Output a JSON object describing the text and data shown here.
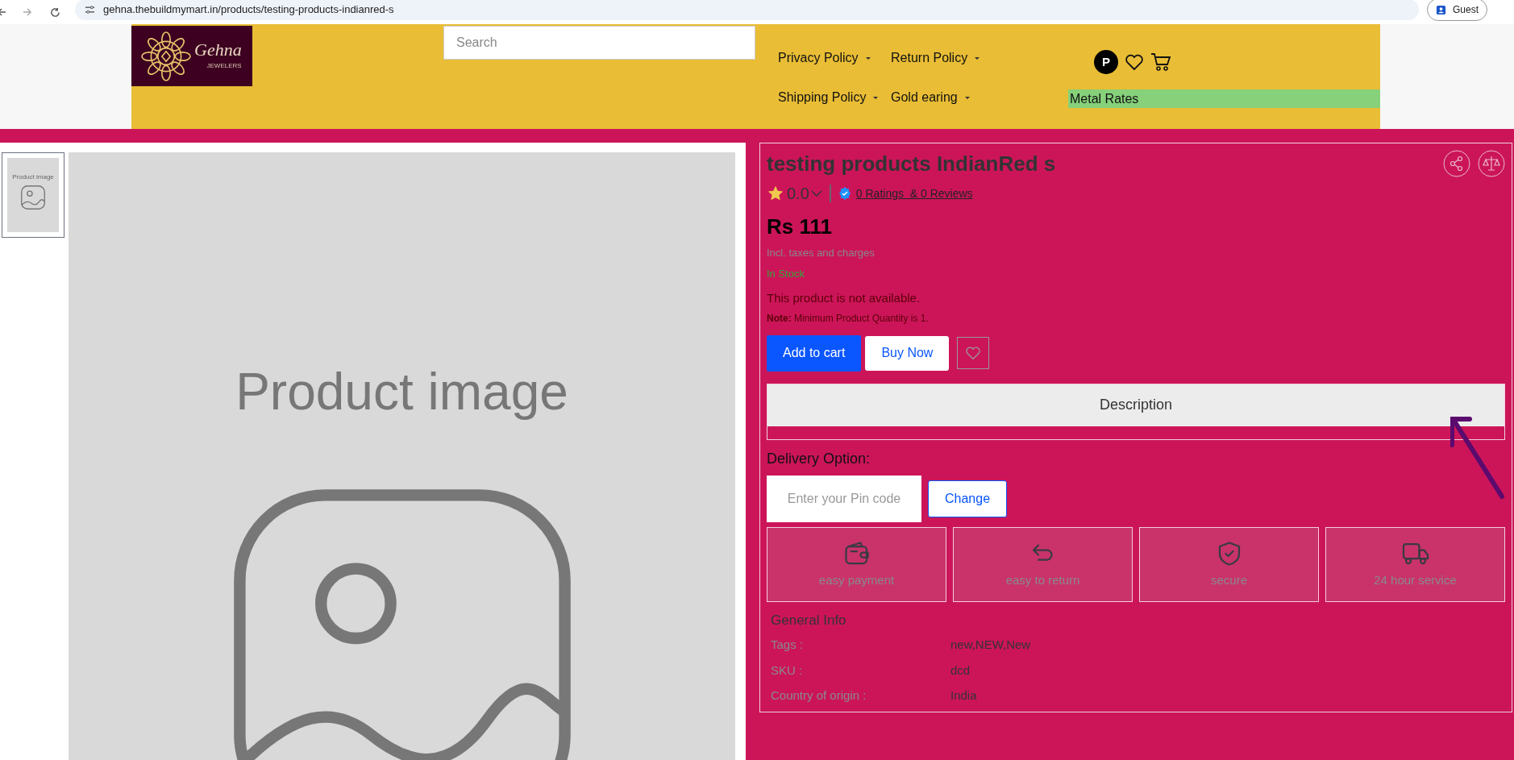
{
  "browser": {
    "url": "gehna.thebuildmymart.in/products/testing-products-indianred-s",
    "profile": "Guest"
  },
  "header": {
    "logo": {
      "name": "Gehna",
      "tagline": "JEWELERS"
    },
    "search": {
      "placeholder": "Search"
    },
    "nav": [
      {
        "label": "Privacy Policy"
      },
      {
        "label": "Return Policy"
      },
      {
        "label": "Shipping Policy"
      },
      {
        "label": "Gold earing"
      }
    ],
    "avatar": "P",
    "metal_rates": "Metal Rates"
  },
  "gallery": {
    "thumbnails": [
      {
        "caption": "Product image",
        "selected": true
      }
    ],
    "main_caption": "Product image"
  },
  "product": {
    "title": "testing products IndianRed s",
    "rating": "0.0",
    "reviews_link": "0 Ratings  & 0 Reviews",
    "price": "Rs 111",
    "tax_note": "Incl. taxes and charges",
    "stock": "In Stock",
    "availability": "This product is not available.",
    "note_label": "Note:",
    "note": "Minimum Product Quantity is 1.",
    "buttons": [
      {
        "label": "Add to cart",
        "kind": "primary"
      },
      {
        "label": "Buy Now",
        "kind": "secondary"
      }
    ],
    "tabs": [
      {
        "label": "Description",
        "selected": true
      }
    ],
    "delivery": {
      "label": "Delivery Option:",
      "placeholder": "Enter your Pin code",
      "button": "Change"
    },
    "features": [
      {
        "kind": "wallet",
        "label": "easy payment"
      },
      {
        "kind": "return",
        "label": "easy to return"
      },
      {
        "kind": "shield",
        "label": "secure"
      },
      {
        "kind": "truck",
        "label": "24 hour service"
      }
    ],
    "general_info": {
      "title": "General Info",
      "rows": [
        {
          "label": "Tags :",
          "value": "new,NEW,New"
        },
        {
          "label": "SKU :",
          "value": "dcd"
        },
        {
          "label": "Country of origin :",
          "value": "India"
        }
      ]
    }
  }
}
